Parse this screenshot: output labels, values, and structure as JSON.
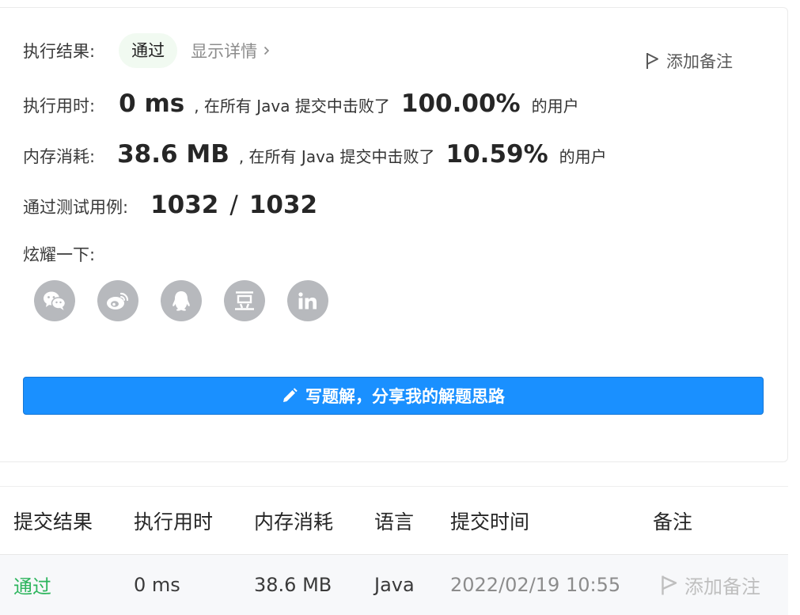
{
  "result": {
    "label": "执行结果:",
    "status": "通过",
    "details_link": "显示详情",
    "note_link": "添加备注"
  },
  "runtime": {
    "label": "执行用时:",
    "value": "0 ms",
    "beat_text": ", 在所有 Java 提交中击败了",
    "percent": "100.00%",
    "suffix": "的用户"
  },
  "memory": {
    "label": "内存消耗:",
    "value": "38.6 MB",
    "beat_text": ", 在所有 Java 提交中击败了",
    "percent": "10.59%",
    "suffix": "的用户"
  },
  "tests": {
    "label": "通过测试用例:",
    "passed": "1032",
    "separator": "/",
    "total": "1032"
  },
  "share": {
    "label": "炫耀一下:",
    "icons": [
      "wechat-icon",
      "weibo-icon",
      "qq-icon",
      "douban-icon",
      "linkedin-icon"
    ]
  },
  "write_button": {
    "label": "写题解，分享我的解题思路"
  },
  "table": {
    "headers": [
      "提交结果",
      "执行用时",
      "内存消耗",
      "语言",
      "提交时间",
      "备注"
    ],
    "rows": [
      {
        "status": "通过",
        "runtime": "0 ms",
        "memory": "38.6 MB",
        "language": "Java",
        "time": "2022/02/19 10:55",
        "note": "添加备注"
      }
    ]
  },
  "colors": {
    "accent": "#1a90ff",
    "pass": "#2db55d",
    "icon_bg": "#b7b9bd"
  }
}
